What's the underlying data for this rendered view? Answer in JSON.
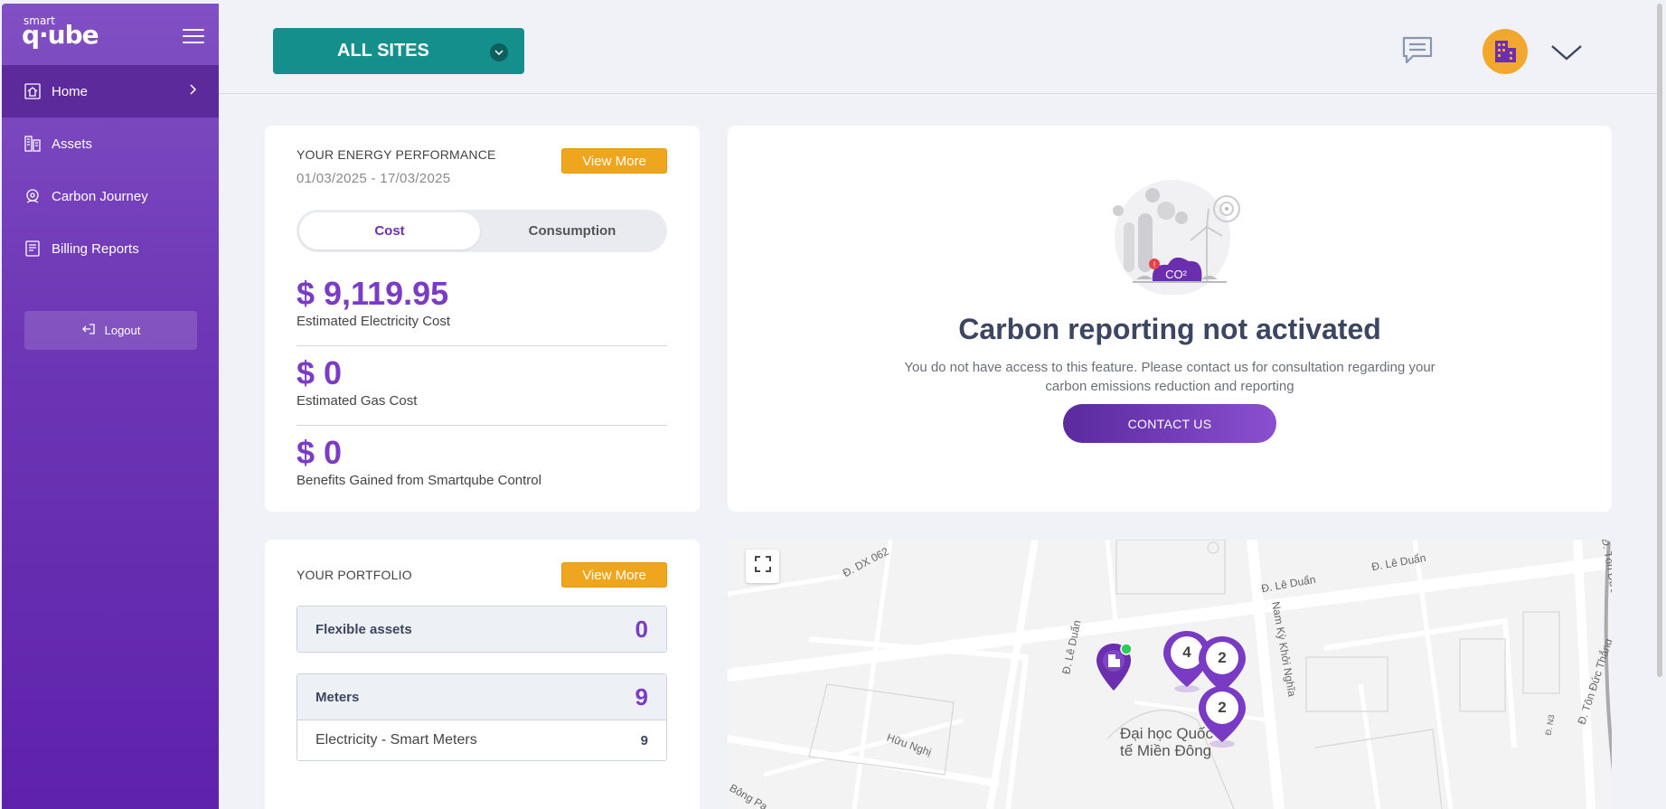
{
  "brand": {
    "logo_small": "smart",
    "logo_big": "q·ube"
  },
  "sidebar": {
    "items": [
      {
        "label": "Home",
        "icon": "home-icon",
        "active": true
      },
      {
        "label": "Assets",
        "icon": "assets-icon"
      },
      {
        "label": "Carbon Journey",
        "icon": "carbon-icon"
      },
      {
        "label": "Billing Reports",
        "icon": "billing-icon"
      }
    ],
    "logout_label": "Logout"
  },
  "header": {
    "site_selector": "ALL SITES"
  },
  "energy": {
    "title": "YOUR ENERGY PERFORMANCE",
    "view_more": "View More",
    "date_range": "01/03/2025 - 17/03/2025",
    "toggle": {
      "cost": "Cost",
      "consumption": "Consumption"
    },
    "electricity_cost": "$ 9,119.95",
    "electricity_label": "Estimated Electricity Cost",
    "gas_cost": "$ 0",
    "gas_label": "Estimated Gas Cost",
    "benefits": "$ 0",
    "benefits_label": "Benefits Gained from Smartqube Control"
  },
  "carbon": {
    "co2_label": "CO²",
    "title": "Carbon reporting not activated",
    "desc_line1": "You do not have access to this feature. Please contact us for consultation regarding your",
    "desc_line2": "carbon emissions reduction and reporting",
    "contact_button": "CONTACT US"
  },
  "portfolio": {
    "title": "YOUR PORTFOLIO",
    "view_more": "View More",
    "flexible_label": "Flexible assets",
    "flexible_value": "0",
    "meters_label": "Meters",
    "meters_value": "9",
    "electricity_meters_label": "Electricity - Smart Meters",
    "electricity_meters_value": "9"
  },
  "map": {
    "streets": [
      "Đ. DX 062",
      "Đ. Lê Duẩn",
      "Đ. Lê Duẩn",
      "Đ. Lê Duẩn",
      "Nam Kỳ Khởi Nghĩa",
      "Đ. Tôn Đức Thắng",
      "Đ. Tôn Đức Thắng",
      "Hữu Nghị",
      "Đ. N3",
      "Bông Pa"
    ],
    "poi_line1": "Đại học Quốc",
    "poi_line2": "tế Miền Đông",
    "clusters": [
      "4",
      "2",
      "2"
    ]
  }
}
